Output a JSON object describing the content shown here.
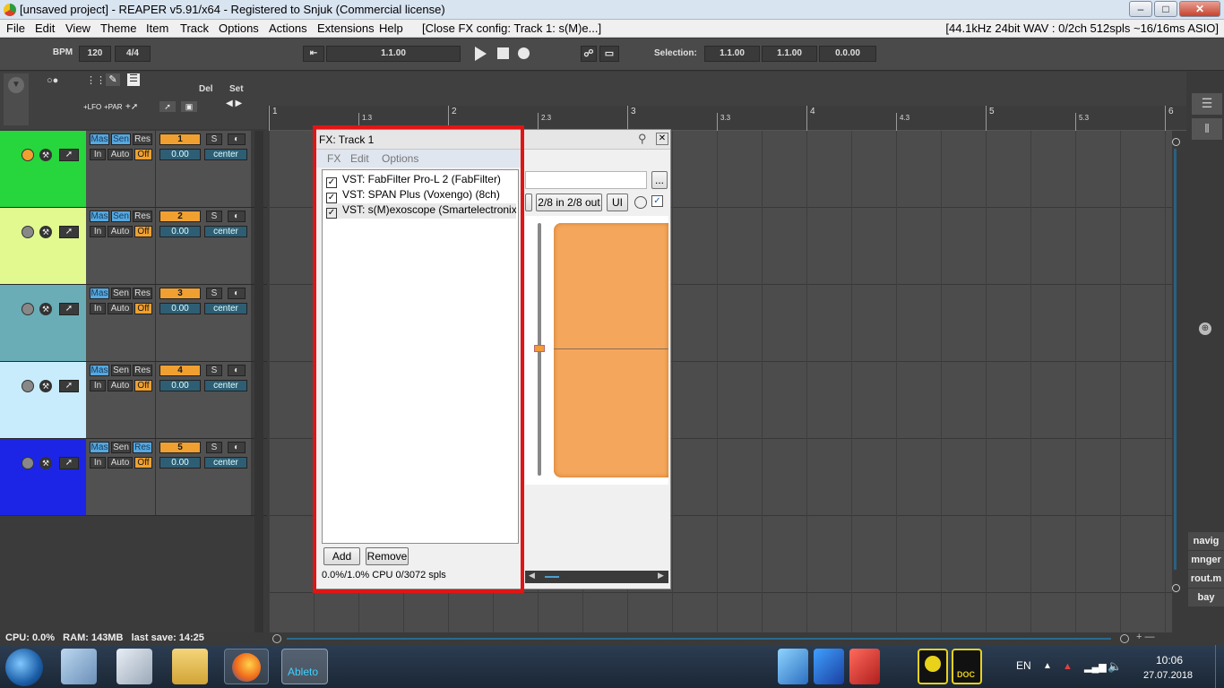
{
  "window": {
    "title": "[unsaved project] - REAPER v5.91/x64 - Registered to Snjuk (Commercial license)"
  },
  "menu": {
    "items": [
      "File",
      "Edit",
      "View",
      "Theme",
      "Item",
      "Track",
      "Options",
      "Actions",
      "Extensions",
      "Help"
    ],
    "action_hint": "[Close FX config: Track 1: s(M)e...]",
    "audio_status": "[44.1kHz 24bit WAV : 0/2ch 512spls ~16/16ms ASIO]"
  },
  "transport": {
    "bpm_label": "BPM",
    "bpm_value": "120",
    "time_sig": "4/4",
    "position": "1.1.00",
    "selection_label": "Selection:",
    "sel_start": "1.1.00",
    "sel_end": "1.1.00",
    "sel_length": "0.0.00"
  },
  "toolbar": {
    "del": "Del",
    "set": "Set",
    "lfo": "+LFO",
    "par": "+PAR"
  },
  "ruler": {
    "labels": [
      "1",
      "1.3",
      "2",
      "2.3",
      "3",
      "3.3",
      "4",
      "4.3",
      "5",
      "5.3",
      "6"
    ]
  },
  "tracks": [
    {
      "num": "1",
      "color": "#26d63c",
      "mas": "Mas",
      "sen": "Sen",
      "res": "Res",
      "in": "In",
      "auto": "Auto",
      "off": "Off",
      "s": "S",
      "vol": "0.00",
      "pan": "center"
    },
    {
      "num": "2",
      "color": "#e2f98f",
      "mas": "Mas",
      "sen": "Sen",
      "res": "Res",
      "in": "In",
      "auto": "Auto",
      "off": "Off",
      "s": "S",
      "vol": "0.00",
      "pan": "center"
    },
    {
      "num": "3",
      "color": "#6aadb6",
      "mas": "Mas",
      "sen": "Sen",
      "res": "Res",
      "in": "In",
      "auto": "Auto",
      "off": "Off",
      "s": "S",
      "vol": "0.00",
      "pan": "center"
    },
    {
      "num": "4",
      "color": "#c8ecfb",
      "mas": "Mas",
      "sen": "Sen",
      "res": "Res",
      "in": "In",
      "auto": "Auto",
      "off": "Off",
      "s": "S",
      "vol": "0.00",
      "pan": "center"
    },
    {
      "num": "5",
      "color": "#1c25e6",
      "mas": "Mas",
      "sen": "Sen",
      "res": "Res",
      "in": "In",
      "auto": "Auto",
      "off": "Off",
      "s": "S",
      "vol": "0.00",
      "pan": "center"
    }
  ],
  "fx_window": {
    "title": "FX: Track 1",
    "menu": [
      "FX",
      "Edit",
      "Options"
    ],
    "plugins": [
      "VST: FabFilter Pro-L 2 (FabFilter)",
      "VST: SPAN Plus (Voxengo) (8ch)",
      "VST: s(M)exoscope (Smartelectronix) (..."
    ],
    "io_button": "2/8 in 2/8 out",
    "ui_button": "UI",
    "browse_button": "...",
    "add_button": "Add",
    "remove_button": "Remove",
    "cpu_status": "0.0%/1.0% CPU 0/3072 spls"
  },
  "side_buttons": [
    "navig",
    "mnger",
    "rout.m",
    "bay"
  ],
  "status": {
    "text": "CPU: 0.0%   RAM: 143MB   last save: 14:25"
  },
  "taskbar": {
    "ableton_label": "Ableto",
    "doc_label": "DOC",
    "lang": "EN",
    "time": "10:06",
    "date": "27.07.2018"
  }
}
